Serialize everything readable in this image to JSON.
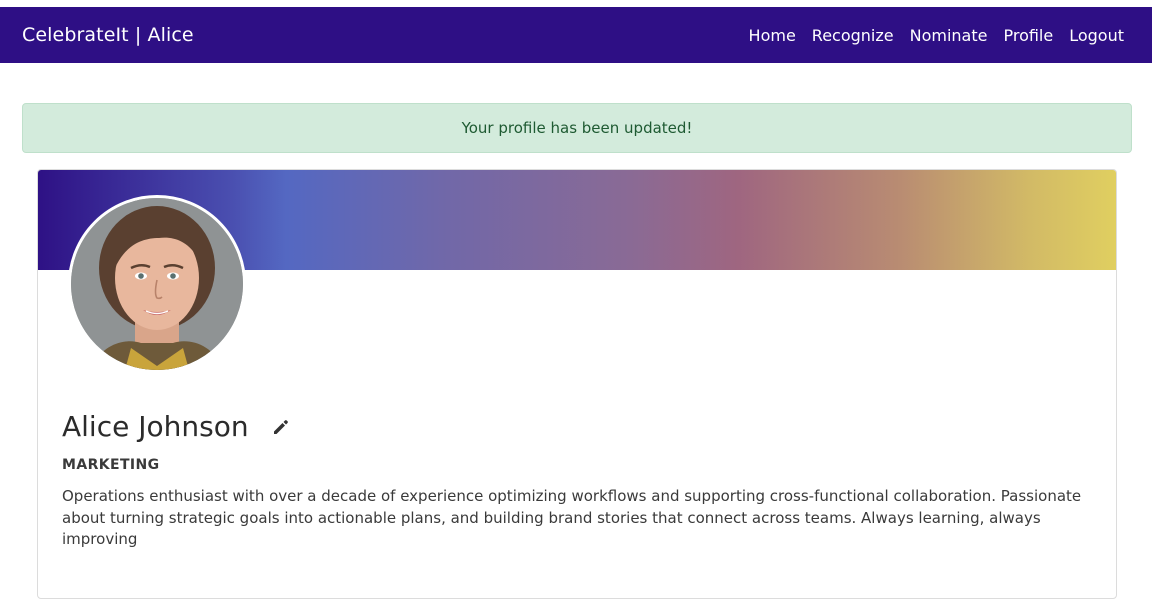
{
  "navbar": {
    "brand": "CelebrateIt | Alice",
    "links": [
      "Home",
      "Recognize",
      "Nominate",
      "Profile",
      "Logout"
    ]
  },
  "alert": {
    "message": "Your profile has been updated!"
  },
  "profile": {
    "name": "Alice Johnson",
    "department": "MARKETING",
    "bio": "Operations enthusiast with over a decade of experience optimizing workflows and supporting cross-functional collaboration. Passionate about turning strategic goals into actionable plans, and building brand stories that connect across teams. Always learning, always improving"
  },
  "colors": {
    "navbar": "#2e0f85",
    "alert_bg": "#d3ebdc",
    "alert_text": "#1e5a32"
  },
  "icons": {
    "edit": "pencil-icon"
  }
}
